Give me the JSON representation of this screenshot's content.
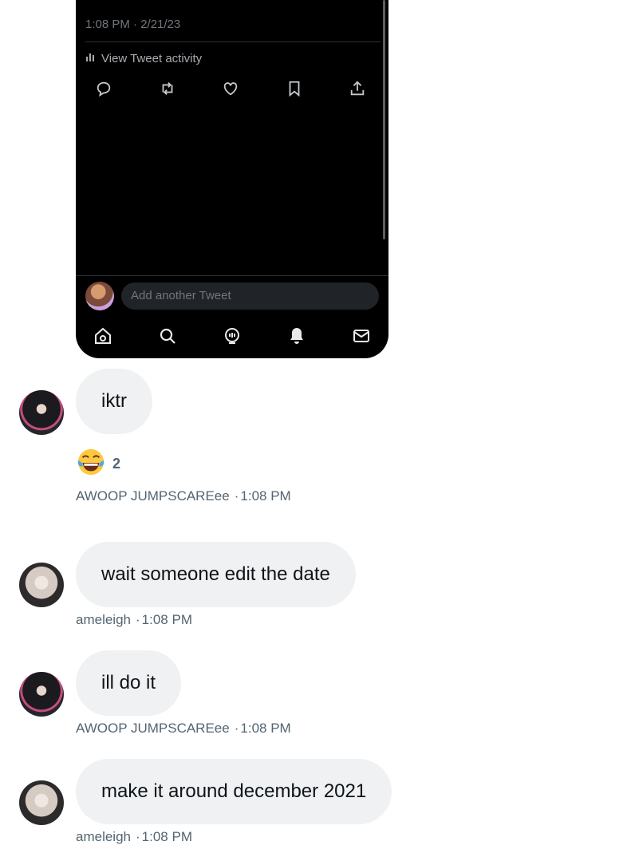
{
  "tweet": {
    "timestamp": "1:08 PM · 2/21/23",
    "activity_label": "View Tweet activity",
    "reply_placeholder": "Add another Tweet"
  },
  "messages": [
    {
      "text": "iktr",
      "author": "AWOOP JUMPSCAREee",
      "time": "1:08 PM"
    },
    {
      "text": "wait someone edit the date",
      "author": "ameleigh",
      "time": "1:08 PM"
    },
    {
      "text": "ill do it",
      "author": "AWOOP JUMPSCAREee",
      "time": "1:08 PM"
    },
    {
      "text": "make it around december 2021",
      "author": "ameleigh",
      "time": "1:08 PM"
    }
  ],
  "reaction": {
    "emoji": "tears-of-joy-emoji",
    "count": "2"
  },
  "separator": "·",
  "colors": {
    "bubble": "#eff1f3",
    "meta": "#536471",
    "dark_bg": "#000000"
  }
}
